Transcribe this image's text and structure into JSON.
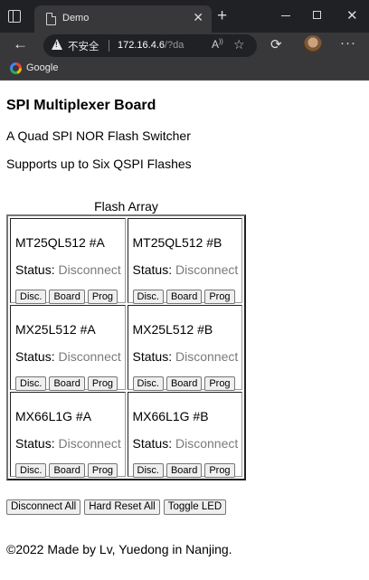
{
  "browser": {
    "tab_title": "Demo",
    "not_secure_label": "不安全",
    "url_host": "172.16.4.6",
    "url_path": "/?da",
    "bookmarks": [
      {
        "label": "Google"
      }
    ]
  },
  "page": {
    "title": "SPI Multiplexer Board",
    "subtitle": "A Quad SPI NOR Flash Switcher",
    "support": "Supports up to Six QSPI Flashes",
    "array_caption": "Flash Array",
    "status_label": "Status:",
    "buttons": {
      "disc": "Disc.",
      "board": "Board",
      "prog": "Prog"
    },
    "flashes": [
      {
        "name": "MT25QL512 #A",
        "status": "Disconnect"
      },
      {
        "name": "MT25QL512 #B",
        "status": "Disconnect"
      },
      {
        "name": "MX25L512 #A",
        "status": "Disconnect"
      },
      {
        "name": "MX25L512 #B",
        "status": "Disconnect"
      },
      {
        "name": "MX66L1G #A",
        "status": "Disconnect"
      },
      {
        "name": "MX66L1G #B",
        "status": "Disconnect"
      }
    ],
    "actions": {
      "disconnect_all": "Disconnect All",
      "hard_reset_all": "Hard Reset All",
      "toggle_led": "Toggle LED"
    },
    "footer": "©2022 Made by Lv, Yuedong in Nanjing."
  }
}
